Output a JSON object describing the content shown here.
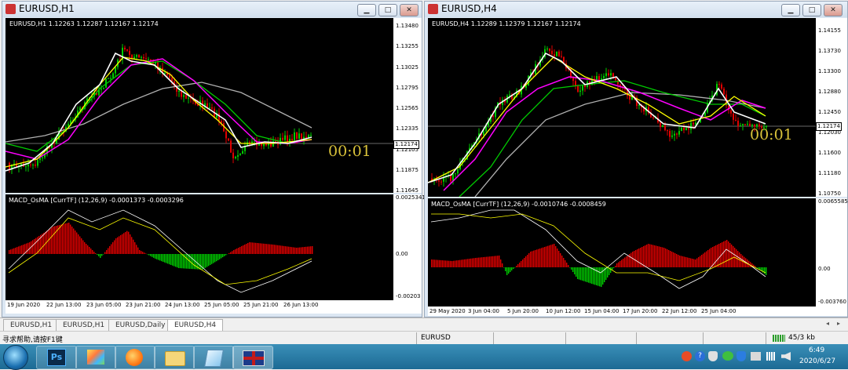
{
  "windows": [
    {
      "id": "w1",
      "title": "EURUSD,H1",
      "info": "EURUSD,H1  1.12263 1.12287 1.12167 1.12174",
      "price_ticks": [
        "1.13480",
        "1.13255",
        "1.13025",
        "1.12795",
        "1.12565",
        "1.12335",
        "1.12105",
        "1.11875",
        "1.11645"
      ],
      "current_price": "1.12174",
      "timer": "00:01",
      "indicator_label": "MACD_OsMA [CurrTF] (12,26,9) -0.0001373 -0.0003296",
      "indicator_ticks": [
        "0.0025341",
        "0.00",
        "-0.00203"
      ],
      "time_ticks": [
        "19 Jun 2020",
        "22 Jun 13:00",
        "23 Jun 05:00",
        "23 Jun 21:00",
        "24 Jun 13:00",
        "25 Jun 05:00",
        "25 Jun 21:00",
        "26 Jun 13:00"
      ]
    },
    {
      "id": "w2",
      "title": "EURUSD,H4",
      "info": "EURUSD,H4  1.12289 1.12379 1.12167 1.12174",
      "price_ticks": [
        "1.14155",
        "1.13730",
        "1.13300",
        "1.12880",
        "1.12450",
        "1.12030",
        "1.11600",
        "1.11180",
        "1.10750"
      ],
      "current_price": "1.12174",
      "timer": "00:01",
      "indicator_label": "MACD_OsMA [CurrTF] (12,26,9) -0.0010746 -0.0008459",
      "indicator_ticks": [
        "0.0065585",
        "0.00",
        "-0.003760"
      ],
      "time_ticks": [
        "29 May 2020",
        "3 Jun 04:00",
        "5 Jun 20:00",
        "10 Jun 12:00",
        "15 Jun 04:00",
        "17 Jun 20:00",
        "22 Jun 12:00",
        "25 Jun 04:00"
      ]
    }
  ],
  "tabs": [
    "EURUSD,H1",
    "EURUSD,H1",
    "EURUSD,Daily",
    "EURUSD,H4"
  ],
  "active_tab": 3,
  "status": {
    "help_text": "寻求帮助,请按F1键",
    "symbol": "EURUSD",
    "traffic": "45/3 kb"
  },
  "taskbar": {
    "time": "6:49",
    "date": "2020/6/27",
    "apps": [
      "start-orb",
      "photoshop-app",
      "paint-app",
      "browser-app",
      "explorer-app",
      "notepad-app",
      "metatrader-app"
    ],
    "ps_label": "Ps"
  },
  "colors": {
    "chart_bg": "#000000",
    "bull": "#00cc00",
    "bear": "#e00000",
    "ma_fast": "#ffffff",
    "ma_yellow": "#ffff00",
    "ma_magenta": "#ff00ff",
    "ma_green": "#00cc00",
    "ma_gray": "#b0b0b0",
    "timer": "#d9c23a"
  }
}
